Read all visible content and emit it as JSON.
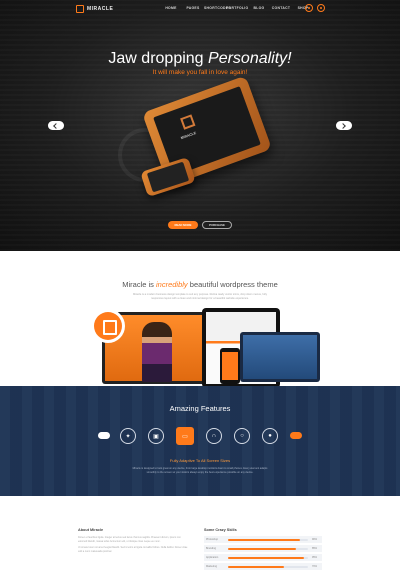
{
  "brand": {
    "name": "MIRACLE",
    "accent": "#ff7a1a"
  },
  "nav": [
    "HOME",
    "PAGES",
    "SHORTCODES",
    "PORTFOLIO",
    "BLOG",
    "CONTACT",
    "SHOP"
  ],
  "hero": {
    "title_plain": "Jaw dropping ",
    "title_em": "Personality!",
    "subtitle": "It will make you fall in love again!",
    "tablet_brand": "MIRACLE",
    "btn_primary": "READ MORE",
    "btn_secondary": "PURCHASE"
  },
  "intro": {
    "title_pre": "Miracle is ",
    "title_hl": "incredibly",
    "title_post": " beautiful wordpress theme",
    "text": "Miracle is a modern business design template to suit any purpose. Retina ready vector icons, drop down menus, fully responsive layout with a clean and minimal design for a beautiful website experience."
  },
  "features": {
    "title": "Amazing Features",
    "icons": [
      "bulb-icon",
      "cart-icon",
      "laptop-icon",
      "headphones-icon",
      "search-icon",
      "drop-icon"
    ],
    "active_index": 2,
    "subtitle": "Fully Adaptive To All Screen Sizes",
    "text": "Miracle is designed to look great on any device, from large desktop monitors down to small phones. Every element adapts smoothly to the screen so your visitors always enjoy the best experience possible on any device."
  },
  "about": {
    "heading": "About Miracle",
    "p1": "Donec et faucibus ligula. Integer at lectus sed lacus rhoncus sagittis. Praesent dictum, ipsum non euismod blandit, massa tellus fermentum elit, ut tristique risus neque eu nunc.",
    "p2": "Ut ornare lorem sit amet feugiat blandit. Sed id enim at ligula convallis finibus. Nulla facilisi. Donec vitae velit a nunc malesuada pulvinar."
  },
  "skills": {
    "heading": "Some Crazy Skills",
    "items": [
      {
        "label": "Photoshop",
        "value": 90,
        "pct": "90%"
      },
      {
        "label": "Branding",
        "value": 85,
        "pct": "85%"
      },
      {
        "label": "Application",
        "value": 95,
        "pct": "95%"
      },
      {
        "label": "Marketing",
        "value": 70,
        "pct": "70%"
      }
    ]
  }
}
